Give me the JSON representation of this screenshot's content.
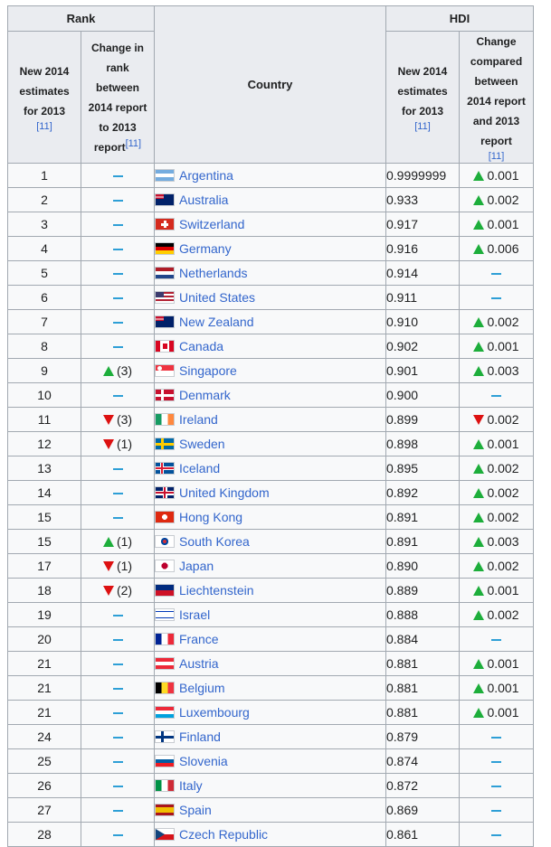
{
  "header": {
    "rank_group": "Rank",
    "hdi_group": "HDI",
    "country": "Country",
    "rank_new": "New 2014 estimates for 2013",
    "rank_change": "Change in rank between 2014 report to 2013 report",
    "hdi_new": "New 2014 estimates for 2013",
    "hdi_change": "Change compared between 2014 report and 2013 report",
    "ref": "[11]"
  },
  "colors": {
    "link": "#3366cc",
    "up": "#1dae3b",
    "down": "#dd1111",
    "dash": "#2e9fd6"
  },
  "rows": [
    {
      "rank": "1",
      "rank_change": null,
      "rank_change_text": "",
      "country": "Argentina",
      "flag": "argentina-flag",
      "hdi": "0.9999999",
      "hdi_change": "up",
      "hdi_change_text": "0.001"
    },
    {
      "rank": "2",
      "rank_change": null,
      "rank_change_text": "",
      "country": "Australia",
      "flag": "australia-flag",
      "hdi": "0.933",
      "hdi_change": "up",
      "hdi_change_text": "0.002"
    },
    {
      "rank": "3",
      "rank_change": null,
      "rank_change_text": "",
      "country": "Switzerland",
      "flag": "switzerland-flag",
      "hdi": "0.917",
      "hdi_change": "up",
      "hdi_change_text": "0.001"
    },
    {
      "rank": "4",
      "rank_change": null,
      "rank_change_text": "",
      "country": "Germany",
      "flag": "germany-flag",
      "hdi": "0.916",
      "hdi_change": "up",
      "hdi_change_text": "0.006"
    },
    {
      "rank": "5",
      "rank_change": null,
      "rank_change_text": "",
      "country": "Netherlands",
      "flag": "netherlands-flag",
      "hdi": "0.914",
      "hdi_change": null,
      "hdi_change_text": ""
    },
    {
      "rank": "6",
      "rank_change": null,
      "rank_change_text": "",
      "country": "United States",
      "flag": "united-states-flag",
      "hdi": "0.911",
      "hdi_change": null,
      "hdi_change_text": ""
    },
    {
      "rank": "7",
      "rank_change": null,
      "rank_change_text": "",
      "country": "New Zealand",
      "flag": "new-zealand-flag",
      "hdi": "0.910",
      "hdi_change": "up",
      "hdi_change_text": "0.002"
    },
    {
      "rank": "8",
      "rank_change": null,
      "rank_change_text": "",
      "country": "Canada",
      "flag": "canada-flag",
      "hdi": "0.902",
      "hdi_change": "up",
      "hdi_change_text": "0.001"
    },
    {
      "rank": "9",
      "rank_change": "up",
      "rank_change_text": "(3)",
      "country": "Singapore",
      "flag": "singapore-flag",
      "hdi": "0.901",
      "hdi_change": "up",
      "hdi_change_text": "0.003"
    },
    {
      "rank": "10",
      "rank_change": null,
      "rank_change_text": "",
      "country": "Denmark",
      "flag": "denmark-flag",
      "hdi": "0.900",
      "hdi_change": null,
      "hdi_change_text": ""
    },
    {
      "rank": "11",
      "rank_change": "down",
      "rank_change_text": "(3)",
      "country": "Ireland",
      "flag": "ireland-flag",
      "hdi": "0.899",
      "hdi_change": "down",
      "hdi_change_text": "0.002"
    },
    {
      "rank": "12",
      "rank_change": "down",
      "rank_change_text": "(1)",
      "country": "Sweden",
      "flag": "sweden-flag",
      "hdi": "0.898",
      "hdi_change": "up",
      "hdi_change_text": "0.001"
    },
    {
      "rank": "13",
      "rank_change": null,
      "rank_change_text": "",
      "country": "Iceland",
      "flag": "iceland-flag",
      "hdi": "0.895",
      "hdi_change": "up",
      "hdi_change_text": "0.002"
    },
    {
      "rank": "14",
      "rank_change": null,
      "rank_change_text": "",
      "country": "United Kingdom",
      "flag": "united-kingdom-flag",
      "hdi": "0.892",
      "hdi_change": "up",
      "hdi_change_text": "0.002"
    },
    {
      "rank": "15",
      "rank_change": null,
      "rank_change_text": "",
      "country": "Hong Kong",
      "flag": "hong-kong-flag",
      "hdi": "0.891",
      "hdi_change": "up",
      "hdi_change_text": "0.002"
    },
    {
      "rank": "15",
      "rank_change": "up",
      "rank_change_text": "(1)",
      "country": "South Korea",
      "flag": "south-korea-flag",
      "hdi": "0.891",
      "hdi_change": "up",
      "hdi_change_text": "0.003"
    },
    {
      "rank": "17",
      "rank_change": "down",
      "rank_change_text": "(1)",
      "country": "Japan",
      "flag": "japan-flag",
      "hdi": "0.890",
      "hdi_change": "up",
      "hdi_change_text": "0.002"
    },
    {
      "rank": "18",
      "rank_change": "down",
      "rank_change_text": "(2)",
      "country": "Liechtenstein",
      "flag": "liechtenstein-flag",
      "hdi": "0.889",
      "hdi_change": "up",
      "hdi_change_text": "0.001"
    },
    {
      "rank": "19",
      "rank_change": null,
      "rank_change_text": "",
      "country": "Israel",
      "flag": "israel-flag",
      "hdi": "0.888",
      "hdi_change": "up",
      "hdi_change_text": "0.002"
    },
    {
      "rank": "20",
      "rank_change": null,
      "rank_change_text": "",
      "country": "France",
      "flag": "france-flag",
      "hdi": "0.884",
      "hdi_change": null,
      "hdi_change_text": ""
    },
    {
      "rank": "21",
      "rank_change": null,
      "rank_change_text": "",
      "country": "Austria",
      "flag": "austria-flag",
      "hdi": "0.881",
      "hdi_change": "up",
      "hdi_change_text": "0.001"
    },
    {
      "rank": "21",
      "rank_change": null,
      "rank_change_text": "",
      "country": "Belgium",
      "flag": "belgium-flag",
      "hdi": "0.881",
      "hdi_change": "up",
      "hdi_change_text": "0.001"
    },
    {
      "rank": "21",
      "rank_change": null,
      "rank_change_text": "",
      "country": "Luxembourg",
      "flag": "luxembourg-flag",
      "hdi": "0.881",
      "hdi_change": "up",
      "hdi_change_text": "0.001"
    },
    {
      "rank": "24",
      "rank_change": null,
      "rank_change_text": "",
      "country": "Finland",
      "flag": "finland-flag",
      "hdi": "0.879",
      "hdi_change": null,
      "hdi_change_text": ""
    },
    {
      "rank": "25",
      "rank_change": null,
      "rank_change_text": "",
      "country": "Slovenia",
      "flag": "slovenia-flag",
      "hdi": "0.874",
      "hdi_change": null,
      "hdi_change_text": ""
    },
    {
      "rank": "26",
      "rank_change": null,
      "rank_change_text": "",
      "country": "Italy",
      "flag": "italy-flag",
      "hdi": "0.872",
      "hdi_change": null,
      "hdi_change_text": ""
    },
    {
      "rank": "27",
      "rank_change": null,
      "rank_change_text": "",
      "country": "Spain",
      "flag": "spain-flag",
      "hdi": "0.869",
      "hdi_change": null,
      "hdi_change_text": ""
    },
    {
      "rank": "28",
      "rank_change": null,
      "rank_change_text": "",
      "country": "Czech Republic",
      "flag": "czech-republic-flag",
      "hdi": "0.861",
      "hdi_change": null,
      "hdi_change_text": ""
    }
  ]
}
